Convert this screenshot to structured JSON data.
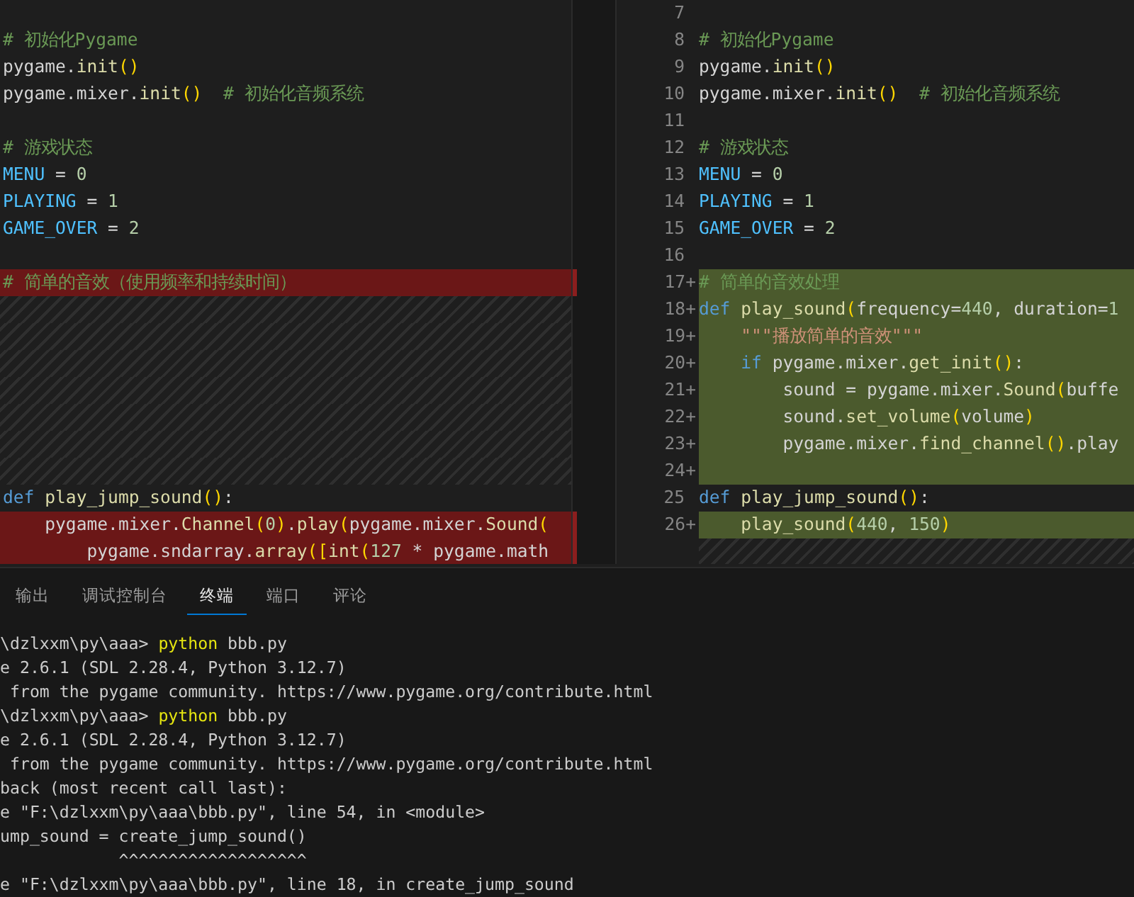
{
  "diff_editor": {
    "left": {
      "lines": [
        {
          "kind": "code"
        },
        {
          "kind": "code",
          "text": "# 初始化Pygame"
        },
        {
          "kind": "code",
          "text": "pygame.init()"
        },
        {
          "kind": "code",
          "text": "pygame.mixer.init()  # 初始化音频系统"
        },
        {
          "kind": "code"
        },
        {
          "kind": "code",
          "text": "# 游戏状态"
        },
        {
          "kind": "code",
          "text": "MENU = 0"
        },
        {
          "kind": "code",
          "text": "PLAYING = 1"
        },
        {
          "kind": "code",
          "text": "GAME_OVER = 2"
        },
        {
          "kind": "code"
        },
        {
          "kind": "removed",
          "text": "# 简单的音效（使用频率和持续时间）"
        },
        {
          "kind": "filler"
        },
        {
          "kind": "filler"
        },
        {
          "kind": "filler"
        },
        {
          "kind": "filler"
        },
        {
          "kind": "filler"
        },
        {
          "kind": "filler"
        },
        {
          "kind": "filler"
        },
        {
          "kind": "code",
          "text": "def play_jump_sound():"
        },
        {
          "kind": "removed",
          "text": "    pygame.mixer.Channel(0).play(pygame.mixer.Sound("
        },
        {
          "kind": "removed",
          "text": "        pygame.sndarray.array([int(127 * pygame.math"
        }
      ]
    },
    "right": {
      "lines": [
        {
          "kind": "code",
          "number": "7"
        },
        {
          "kind": "code",
          "number": "8",
          "text": "# 初始化Pygame"
        },
        {
          "kind": "code",
          "number": "9",
          "text": "pygame.init()"
        },
        {
          "kind": "code",
          "number": "10",
          "text": "pygame.mixer.init()  # 初始化音频系统"
        },
        {
          "kind": "code",
          "number": "11"
        },
        {
          "kind": "code",
          "number": "12",
          "text": "# 游戏状态"
        },
        {
          "kind": "code",
          "number": "13",
          "text": "MENU = 0"
        },
        {
          "kind": "code",
          "number": "14",
          "text": "PLAYING = 1"
        },
        {
          "kind": "code",
          "number": "15",
          "text": "GAME_OVER = 2"
        },
        {
          "kind": "code",
          "number": "16"
        },
        {
          "kind": "added",
          "number": "17",
          "marker": "+",
          "text": "# 简单的音效处理"
        },
        {
          "kind": "added",
          "number": "18",
          "marker": "+",
          "text": "def play_sound(frequency=440, duration=1"
        },
        {
          "kind": "added",
          "number": "19",
          "marker": "+",
          "text": "    \"\"\"播放简单的音效\"\"\""
        },
        {
          "kind": "added",
          "number": "20",
          "marker": "+",
          "text": "    if pygame.mixer.get_init():"
        },
        {
          "kind": "added",
          "number": "21",
          "marker": "+",
          "text": "        sound = pygame.mixer.Sound(buffe"
        },
        {
          "kind": "added",
          "number": "22",
          "marker": "+",
          "text": "        sound.set_volume(volume)"
        },
        {
          "kind": "added",
          "number": "23",
          "marker": "+",
          "text": "        pygame.mixer.find_channel().play"
        },
        {
          "kind": "added",
          "number": "24",
          "marker": "+"
        },
        {
          "kind": "code",
          "number": "25",
          "text": "def play_jump_sound():"
        },
        {
          "kind": "added",
          "number": "26",
          "marker": "+",
          "text": "    play_sound(440, 150)"
        },
        {
          "kind": "filler"
        }
      ]
    }
  },
  "panel": {
    "tabs": [
      {
        "label": "输出",
        "selected": false
      },
      {
        "label": "调试控制台",
        "selected": false
      },
      {
        "label": "终端",
        "selected": true
      },
      {
        "label": "端口",
        "selected": false
      },
      {
        "label": "评论",
        "selected": false
      }
    ],
    "terminal": {
      "lines": [
        "\\dzlxxm\\py\\aaa> python bbb.py",
        "e 2.6.1 (SDL 2.28.4, Python 3.12.7)",
        " from the pygame community. https://www.pygame.org/contribute.html",
        "\\dzlxxm\\py\\aaa> python bbb.py",
        "e 2.6.1 (SDL 2.28.4, Python 3.12.7)",
        " from the pygame community. https://www.pygame.org/contribute.html",
        "back (most recent call last):",
        "e \"F:\\dzlxxm\\py\\aaa\\bbb.py\", line 54, in <module>",
        "ump_sound = create_jump_sound()",
        "            ^^^^^^^^^^^^^^^^^^^",
        "e \"F:\\dzlxxm\\py\\aaa\\bbb.py\", line 18, in create_jump_sound"
      ]
    }
  }
}
